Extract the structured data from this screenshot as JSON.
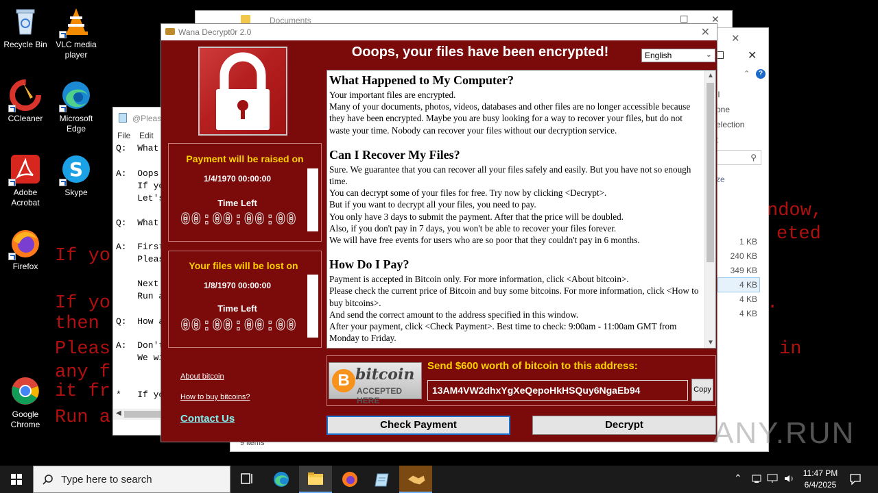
{
  "desktop": {
    "icons": [
      {
        "label": "Recycle Bin"
      },
      {
        "label": "VLC media player"
      },
      {
        "label": "CCleaner"
      },
      {
        "label": "Microsoft Edge"
      },
      {
        "label": "Adobe Acrobat"
      },
      {
        "label": "Skype"
      },
      {
        "label": "Firefox"
      },
      {
        "label": "Google Chrome"
      }
    ],
    "wallpaper_lines": [
      "If yo",
      "then",
      "it fr",
      "If yo",
      "Pleas",
      "any f",
      "Run a"
    ],
    "wallpaper_right": [
      "ndow,",
      "eted",
      ".",
      "in"
    ]
  },
  "docs_window": {
    "title": "Documents"
  },
  "explorer": {
    "side": [
      "ll",
      "one",
      "election",
      "t"
    ],
    "size_header": "ze",
    "sizes": [
      "1 KB",
      "240 KB",
      "349 KB",
      "4 KB",
      "4 KB",
      "4 KB"
    ],
    "status": "9 items"
  },
  "notepad": {
    "title": "@Please",
    "menu": [
      "File",
      "Edit"
    ],
    "lines": [
      "Q:  What",
      "A:  Oops",
      "    If yo",
      "    Let's",
      "Q:  What",
      "A:  First",
      "    Pleas",
      "    Next",
      "    Run a",
      "Q:  How a",
      "A:  Don't",
      "    We wi",
      "*   If yo"
    ]
  },
  "wannacry": {
    "title": "Wana Decrypt0r 2.0",
    "header": "Ooops, your files have been encrypted!",
    "language": "English",
    "raise_panel": {
      "heading": "Payment will be raised on",
      "date": "1/4/1970 00:00:00",
      "time_left_label": "Time Left",
      "countdown": "00:00:00:00"
    },
    "lost_panel": {
      "heading": "Your files will be lost on",
      "date": "1/8/1970 00:00:00",
      "time_left_label": "Time Left",
      "countdown": "00:00:00:00"
    },
    "links": {
      "about": "About bitcoin",
      "howto": "How to buy bitcoins?",
      "contact": "Contact Us"
    },
    "sections": [
      {
        "heading": "What Happened to My Computer?",
        "paragraphs": [
          "Your important files are encrypted.",
          "Many of your documents, photos, videos, databases and other files are no longer accessible because they have been encrypted. Maybe you are busy looking for a way to recover your files, but do not waste your time. Nobody can recover your files without our decryption service."
        ]
      },
      {
        "heading": "Can I Recover My Files?",
        "paragraphs": [
          "Sure. We guarantee that you can recover all your files safely and easily. But you have not so enough time.",
          "You can decrypt some of your files for free. Try now by clicking <Decrypt>.",
          "But if you want to decrypt all your files, you need to pay.",
          "You only have 3 days to submit the payment. After that the price will be doubled.",
          "Also, if you don't pay in 7 days, you won't be able to recover your files forever.",
          "We will have free events for users who are so poor that they couldn't pay in 6 months."
        ]
      },
      {
        "heading": "How Do I Pay?",
        "paragraphs": [
          "Payment is accepted in Bitcoin only. For more information, click <About bitcoin>.",
          "Please check the current price of Bitcoin and buy some bitcoins. For more information, click <How to buy bitcoins>.",
          "And send the correct amount to the address specified in this window.",
          "After your payment, click <Check Payment>. Best time to check: 9:00am - 11:00am GMT from Monday to Friday."
        ]
      }
    ],
    "bitcoin_logo": {
      "word": "bitcoin",
      "tagline": "ACCEPTED HERE"
    },
    "send_label": "Send $600 worth of bitcoin to this address:",
    "address": "13AM4VW2dhxYgXeQepoHkHSQuy6NgaEb94",
    "copy_label": "Copy",
    "check_payment_label": "Check Payment",
    "decrypt_label": "Decrypt"
  },
  "watermark": "ANY.RUN",
  "taskbar": {
    "search_placeholder": "Type here to search",
    "time": "11:47 PM",
    "date": "6/4/2025"
  }
}
